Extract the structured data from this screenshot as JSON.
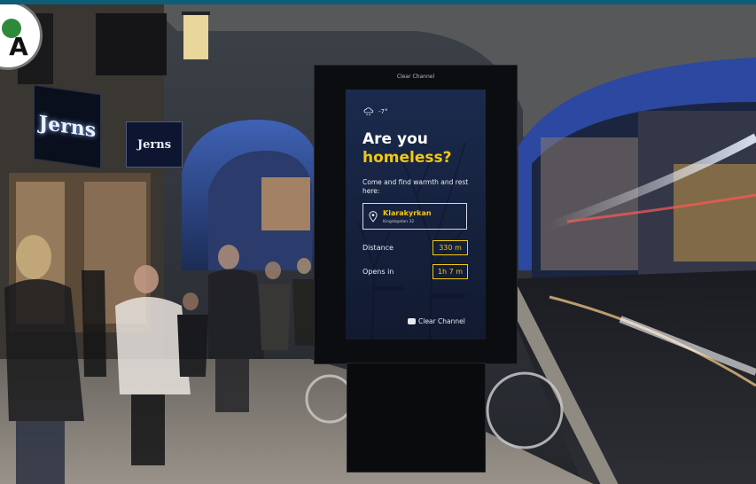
{
  "storefront": {
    "sign_main": "Jerns",
    "sign_small": "Jerns"
  },
  "logo_badge": {
    "letter": "A"
  },
  "kiosk": {
    "top_brand": "Clear Channel",
    "weather": {
      "icon": "cloud-snow-icon",
      "temperature": "-7°"
    },
    "headline_line1": "Are you",
    "headline_line2": "homeless?",
    "subtext": "Come and find warmth and rest here:",
    "location": {
      "icon": "location-pin-icon",
      "name": "Klarakyrkan",
      "address": "Kingsbgatan 32"
    },
    "distance_label": "Distance",
    "distance_value": "330 m",
    "opens_label": "Opens in",
    "opens_value": "1h 7 m",
    "bottom_brand": "Clear Channel"
  },
  "colors": {
    "accent_yellow": "#f2c811",
    "screen_bg": "#1b2a4d",
    "frame_border": "#0c5f76"
  }
}
